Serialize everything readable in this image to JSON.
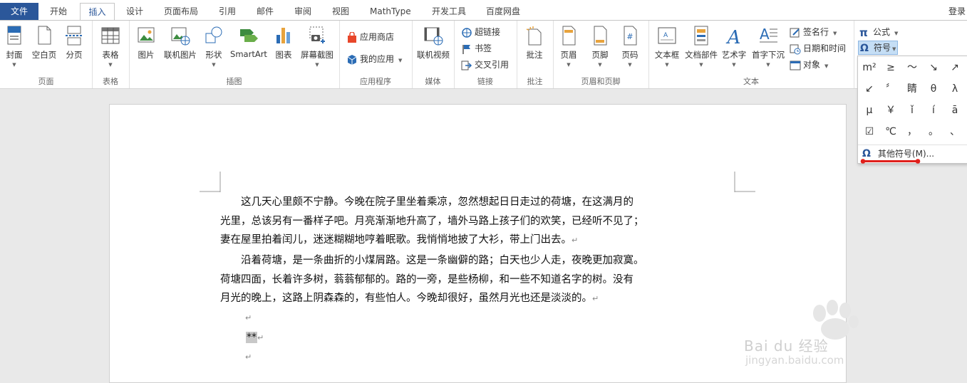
{
  "tabs": [
    {
      "label": "文件"
    },
    {
      "label": "开始"
    },
    {
      "label": "插入"
    },
    {
      "label": "设计"
    },
    {
      "label": "页面布局"
    },
    {
      "label": "引用"
    },
    {
      "label": "邮件"
    },
    {
      "label": "审阅"
    },
    {
      "label": "视图"
    },
    {
      "label": "MathType"
    },
    {
      "label": "开发工具"
    },
    {
      "label": "百度网盘"
    }
  ],
  "active_tab": "插入",
  "login": "登录",
  "groups": {
    "pages": {
      "label": "页面",
      "cover": "封面",
      "blank": "空白页",
      "break": "分页"
    },
    "tables": {
      "label": "表格",
      "table": "表格"
    },
    "illustrations": {
      "label": "插图",
      "picture": "图片",
      "online_picture": "联机图片",
      "shapes": "形状",
      "smartart": "SmartArt",
      "chart": "图表",
      "screenshot": "屏幕截图"
    },
    "apps": {
      "label": "应用程序",
      "store": "应用商店",
      "myapps": "我的应用"
    },
    "media": {
      "label": "媒体",
      "online_video": "联机视频"
    },
    "links": {
      "label": "链接",
      "hyperlink": "超链接",
      "bookmark": "书签",
      "crossref": "交叉引用"
    },
    "comments": {
      "label": "批注",
      "comment": "批注"
    },
    "header_footer": {
      "label": "页眉和页脚",
      "header": "页眉",
      "footer": "页脚",
      "page_number": "页码"
    },
    "text": {
      "label": "文本",
      "textbox": "文本框",
      "quickparts": "文档部件",
      "wordart": "艺术字",
      "dropcap": "首字下沉",
      "signature": "签名行",
      "datetime": "日期和时间",
      "object": "对象"
    },
    "symbols": {
      "equation": "公式",
      "symbol": "符号"
    }
  },
  "symbol_dropdown": {
    "symbols": [
      "m²",
      "≥",
      "～",
      "↘",
      "↗",
      "↙",
      "〞",
      "睛",
      "θ",
      "λ",
      "μ",
      "￥",
      "ǐ",
      "í",
      "ā",
      "☑",
      "℃",
      "，",
      "。",
      "、"
    ],
    "more_label": "其他符号(M)..."
  },
  "document": {
    "para1": [
      "　　这几天心里颇不宁静。今晚在院子里坐着乘凉，忽然想起日日走过的荷塘，在这满月的",
      "光里，总该另有一番样子吧。月亮渐渐地升高了，墙外马路上孩子们的欢笑，已经听不见了；",
      "妻在屋里拍着闰儿，迷迷糊糊地哼着眠歌。我悄悄地披了大衫，带上门出去。"
    ],
    "para2": [
      "　　沿着荷塘，是一条曲折的小煤屑路。这是一条幽僻的路；白天也少人走，夜晚更加寂寞。",
      "荷塘四面，长着许多树，蓊蓊郁郁的。路的一旁，是些杨柳，和一些不知道名字的树。没有",
      "月光的晚上，这路上阴森森的，有些怕人。今晚却很好，虽然月光也还是淡淡的。"
    ],
    "selected_text": "**",
    "para_mark": "↵"
  },
  "watermark": {
    "brand": "Bai du 经验",
    "url": "jingyan.baidu.com"
  },
  "colors": {
    "file_tab": "#2b579a",
    "accent": "#2b579a",
    "annotation": "#e0201c"
  }
}
